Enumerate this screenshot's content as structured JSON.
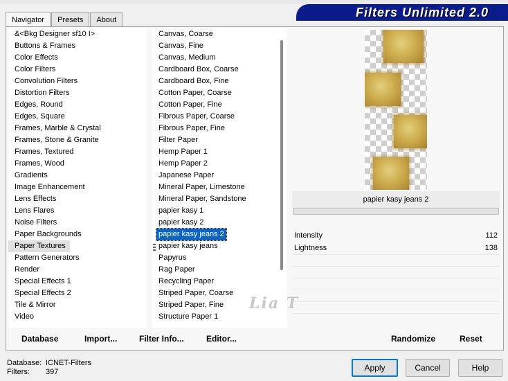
{
  "tabs": [
    "Navigator",
    "Presets",
    "About"
  ],
  "banner": "Filters Unlimited 2.0",
  "categories": [
    "&<Bkg Designer sf10 I>",
    "Buttons & Frames",
    "Color Effects",
    "Color Filters",
    "Convolution Filters",
    "Distortion Filters",
    "Edges, Round",
    "Edges, Square",
    "Frames, Marble & Crystal",
    "Frames, Stone & Granite",
    "Frames, Textured",
    "Frames, Wood",
    "Gradients",
    "Image Enhancement",
    "Lens Effects",
    "Lens Flares",
    "Noise Filters",
    "Paper Backgrounds",
    "Paper Textures",
    "Pattern Generators",
    "Render",
    "Special Effects 1",
    "Special Effects 2",
    "Tile & Mirror",
    "Video"
  ],
  "selected_category": "Paper Textures",
  "filters": [
    "Canvas, Coarse",
    "Canvas, Fine",
    "Canvas, Medium",
    "Cardboard Box, Coarse",
    "Cardboard Box, Fine",
    "Cotton Paper, Coarse",
    "Cotton Paper, Fine",
    "Fibrous Paper, Coarse",
    "Fibrous Paper, Fine",
    "Filter Paper",
    "Hemp Paper 1",
    "Hemp Paper 2",
    "Japanese Paper",
    "Mineral Paper, Limestone",
    "Mineral Paper, Sandstone",
    "papier kasy 1",
    "papier kasy 2",
    "papier kasy jeans 2",
    "papier kasy jeans",
    "Papyrus",
    "Rag Paper",
    "Recycling Paper",
    "Striped Paper, Coarse",
    "Striped Paper, Fine",
    "Structure Paper 1"
  ],
  "selected_filter": "papier kasy jeans 2",
  "filter_name": "papier kasy jeans 2",
  "params": [
    {
      "label": "Intensity",
      "value": "112"
    },
    {
      "label": "Lightness",
      "value": "138"
    }
  ],
  "watermark": "Lia T",
  "left_buttons": {
    "database": "Database",
    "import": "Import...",
    "filter_info": "Filter Info...",
    "editor": "Editor..."
  },
  "right_buttons": {
    "randomize": "Randomize",
    "reset": "Reset"
  },
  "footer": {
    "database_label": "Database:",
    "database_value": "ICNET-Filters",
    "filters_label": "Filters:",
    "filters_value": "397"
  },
  "dialog_buttons": {
    "apply": "Apply",
    "cancel": "Cancel",
    "help": "Help"
  },
  "colors": {
    "selection": "#0a64c8",
    "banner": "#0a1c8a",
    "gold": "#cfae4f"
  }
}
